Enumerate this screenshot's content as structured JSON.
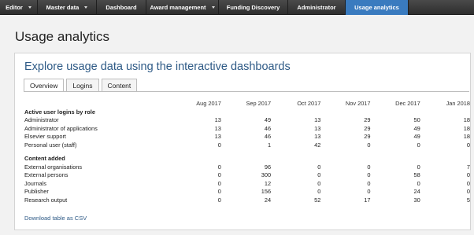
{
  "nav": {
    "items": [
      {
        "label": "Editor",
        "has_dropdown": true
      },
      {
        "label": "Master data",
        "has_dropdown": true
      },
      {
        "label": "Dashboard",
        "has_dropdown": false
      },
      {
        "label": "Award management",
        "has_dropdown": true
      },
      {
        "label": "Funding Discovery",
        "has_dropdown": false
      },
      {
        "label": "Administrator",
        "has_dropdown": false
      },
      {
        "label": "Usage analytics",
        "has_dropdown": false,
        "active": true
      }
    ]
  },
  "page": {
    "title": "Usage analytics"
  },
  "card": {
    "heading": "Explore usage data using the interactive dashboards",
    "tabs": [
      {
        "label": "Overview",
        "active": true
      },
      {
        "label": "Logins",
        "active": false
      },
      {
        "label": "Content",
        "active": false
      }
    ],
    "download_link": "Download table as CSV"
  },
  "table": {
    "columns": [
      "Aug 2017",
      "Sep 2017",
      "Oct 2017",
      "Nov 2017",
      "Dec 2017",
      "Jan 2018"
    ],
    "sections": [
      {
        "title": "Active user logins by role",
        "rows": [
          {
            "label": "Administrator",
            "values": [
              "13",
              "49",
              "13",
              "29",
              "50",
              "18"
            ]
          },
          {
            "label": "Administrator of applications",
            "values": [
              "13",
              "46",
              "13",
              "29",
              "49",
              "18"
            ]
          },
          {
            "label": "Elsevier support",
            "values": [
              "13",
              "46",
              "13",
              "29",
              "49",
              "18"
            ]
          },
          {
            "label": "Personal user (staff)",
            "values": [
              "0",
              "1",
              "42",
              "0",
              "0",
              "0"
            ]
          }
        ]
      },
      {
        "title": "Content added",
        "rows": [
          {
            "label": "External organisations",
            "values": [
              "0",
              "96",
              "0",
              "0",
              "0",
              "7"
            ]
          },
          {
            "label": "External persons",
            "values": [
              "0",
              "300",
              "0",
              "0",
              "58",
              "0"
            ]
          },
          {
            "label": "Journals",
            "values": [
              "0",
              "12",
              "0",
              "0",
              "0",
              "0"
            ]
          },
          {
            "label": "Publisher",
            "values": [
              "0",
              "156",
              "0",
              "0",
              "24",
              "0"
            ]
          },
          {
            "label": "Research output",
            "values": [
              "0",
              "24",
              "52",
              "17",
              "30",
              "5"
            ]
          }
        ]
      }
    ]
  },
  "colors": {
    "nav_bg": "#3a3a3a",
    "nav_active": "#3a7bbf",
    "heading_blue": "#2e5a86"
  }
}
